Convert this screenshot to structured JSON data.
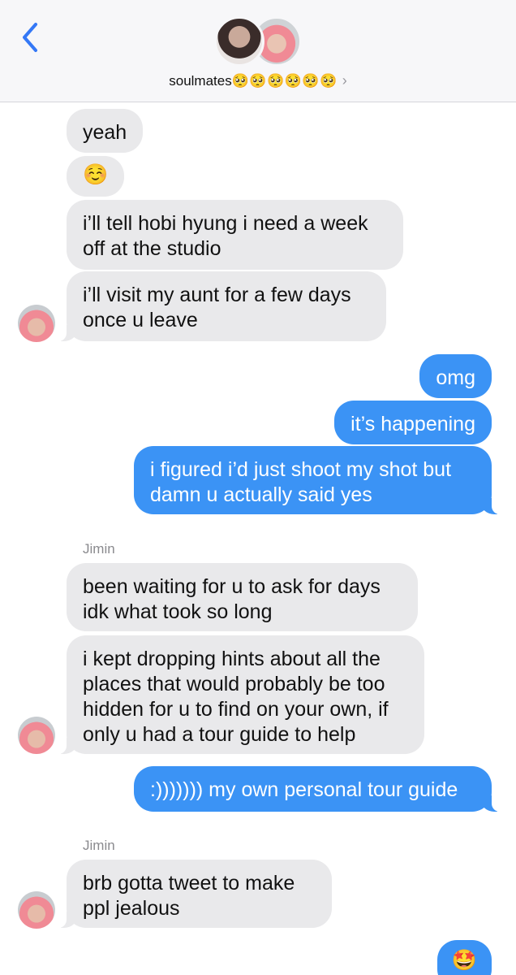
{
  "header": {
    "back_icon": "chevron-left-icon",
    "group_name": "soulmates",
    "group_emojis": "🥺🥺🥺🥺🥺🥺",
    "disclosure": "›"
  },
  "messages": [
    {
      "side": "in",
      "text": "yeah"
    },
    {
      "side": "in",
      "text": "☺️"
    },
    {
      "side": "in",
      "text": "i’ll tell hobi hyung i need a week\noff at the studio"
    },
    {
      "side": "in",
      "text": "i’ll visit my aunt for a few days\nonce u leave"
    },
    {
      "side": "out",
      "text": "omg"
    },
    {
      "side": "out",
      "text": "it’s happening"
    },
    {
      "side": "out",
      "text": "i figured i’d just shoot my shot but\ndamn u actually said yes"
    },
    {
      "side": "in",
      "sender": "Jimin",
      "text": "been waiting for u to ask for days\nidk what took so long"
    },
    {
      "side": "in",
      "text": "i kept dropping hints about all the\nplaces that would probably be too\nhidden for u to find on your own, if\nonly u had a tour guide to help"
    },
    {
      "side": "out",
      "text": ":))))))) my own personal tour guide"
    },
    {
      "side": "in",
      "sender": "Jimin",
      "text": "brb gotta tweet to make\nppl jealous"
    },
    {
      "side": "out",
      "text": "🤩"
    }
  ],
  "colors": {
    "incoming": "#e9e9eb",
    "outgoing": "#3b93f5",
    "accent": "#3478f6"
  }
}
